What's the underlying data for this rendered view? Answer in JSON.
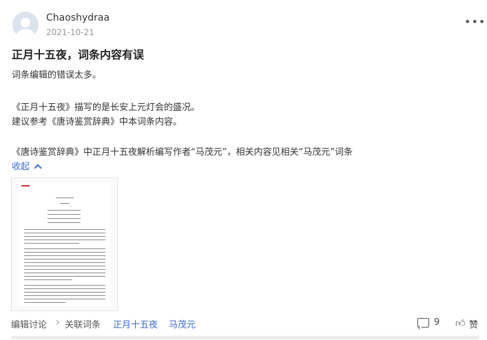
{
  "post": {
    "username": "Chaoshydraa",
    "date": "2021-10-21",
    "title": "正月十五夜，词条内容有误",
    "paragraphs": [
      "词条编辑的错误太多。",
      "《正月十五夜》描写的是长安上元灯会的盛况。",
      "建议参考《唐诗鉴赏辞典》中本词条内容。",
      "《唐诗鉴赏辞典》中正月十五夜解析编写作者“马茂元”，相关内容见相关“马茂元”词条"
    ],
    "collapse_label": "收起"
  },
  "footer": {
    "edit_discussion": "编辑讨论",
    "related_entries": "关联词条",
    "tags": [
      "正月十五夜",
      "马茂元"
    ],
    "comment_count": "9",
    "like_label": "赞"
  },
  "icons": {
    "more": "more-icon",
    "comment": "comment-icon",
    "like": "thumbs-up-icon"
  },
  "colors": {
    "link": "#3b6bd6"
  }
}
